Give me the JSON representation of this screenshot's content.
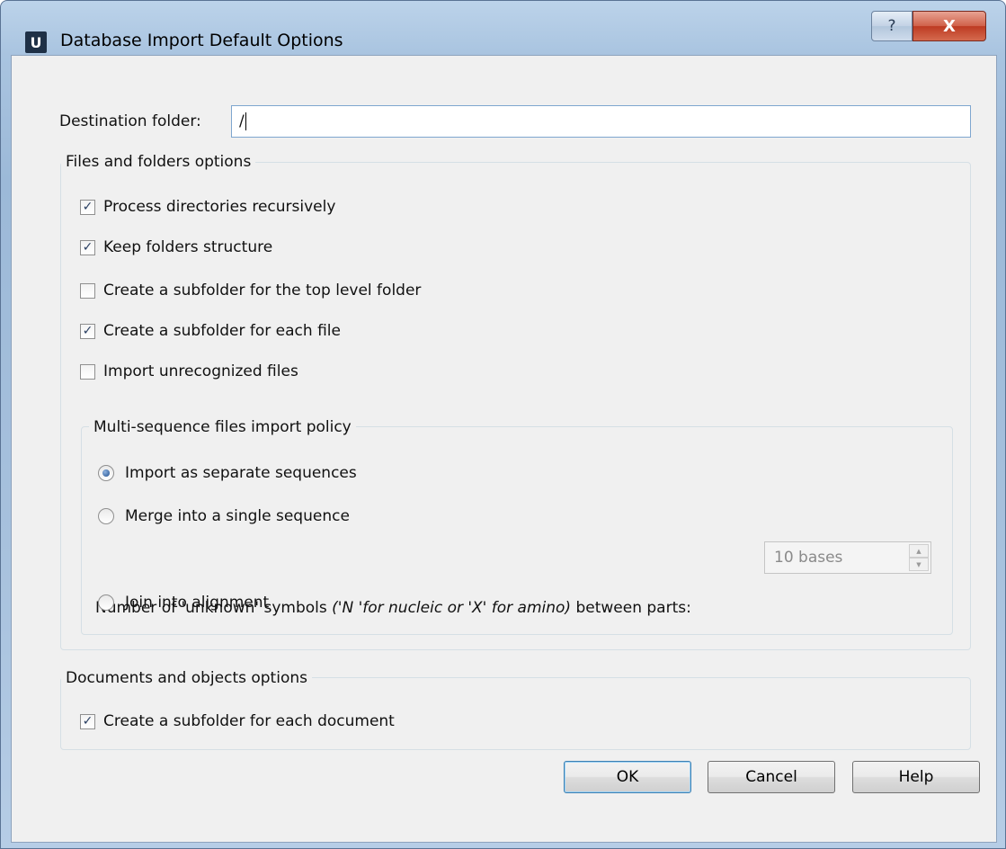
{
  "window": {
    "app_logo": "U",
    "title": "Database Import Default Options",
    "help_caption": "?",
    "close_caption": "X"
  },
  "destination": {
    "label": "Destination folder:",
    "value": "/"
  },
  "files_group": {
    "title": "Files and folders options",
    "options": [
      {
        "label": "Process directories recursively",
        "checked": true
      },
      {
        "label": "Keep folders structure",
        "checked": true
      },
      {
        "label": "Create a subfolder for the top level folder",
        "checked": false
      },
      {
        "label": "Create a subfolder for each file",
        "checked": true
      },
      {
        "label": "Import unrecognized files",
        "checked": false
      }
    ]
  },
  "multi_group": {
    "title": "Multi-sequence files import policy",
    "radios": [
      {
        "label": "Import as separate sequences",
        "selected": true
      },
      {
        "label": "Merge into a single sequence",
        "selected": false
      },
      {
        "label": "Join into alignment",
        "selected": false
      }
    ],
    "unknown_label_prefix": "Number of 'unknown' symbols ",
    "unknown_label_hint": "('N 'for nucleic or 'X' for amino)",
    "unknown_label_suffix": " between parts:",
    "unknown_value": "10 bases"
  },
  "docs_group": {
    "title": "Documents and objects options",
    "options": [
      {
        "label": "Create a subfolder for each document",
        "checked": true
      }
    ]
  },
  "buttons": {
    "ok": "OK",
    "cancel": "Cancel",
    "help": "Help"
  },
  "colors": {
    "titlebar": "#a9c4e0",
    "close_button": "#c8462e",
    "dialog_bg": "#f0f0f0",
    "check_mark": "#2a3f62"
  }
}
